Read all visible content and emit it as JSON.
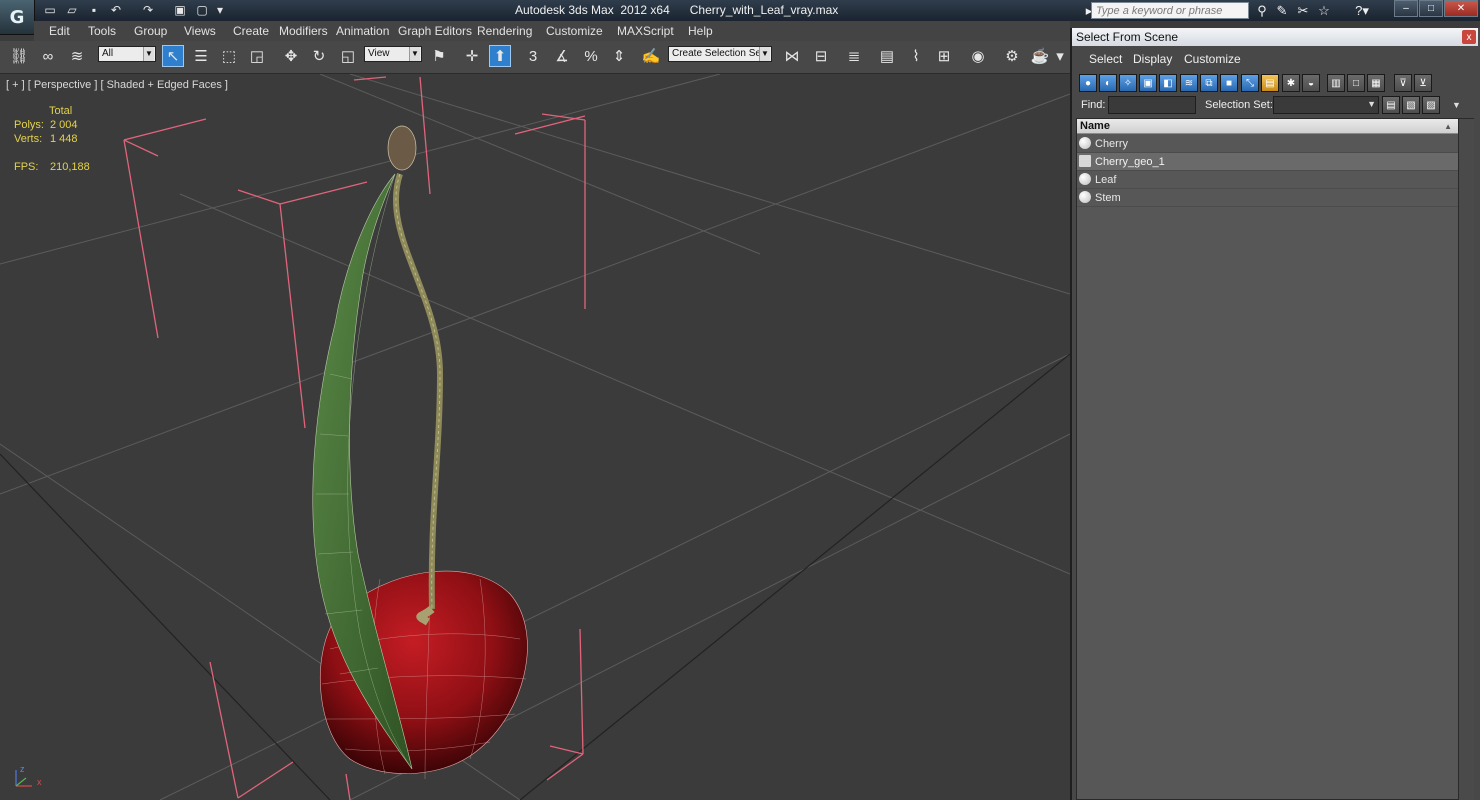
{
  "app": {
    "title": "Autodesk 3ds Max  2012 x64      Cherry_with_Leaf_vray.max",
    "search_placeholder": "Type a keyword or phrase"
  },
  "menu": [
    "Edit",
    "Tools",
    "Group",
    "Views",
    "Create",
    "Modifiers",
    "Animation",
    "Graph Editors",
    "Rendering",
    "Customize",
    "MAXScript",
    "Help"
  ],
  "toolbar": {
    "filter_value": "All",
    "refcoord_value": "View",
    "selection_set_value": "Create Selection Se",
    "snap_labels": [
      "3",
      "%"
    ]
  },
  "viewport": {
    "label": "[ + ] [ Perspective ] [ Shaded + Edged Faces ]",
    "stats_header": "Total",
    "polys_label": "Polys:",
    "polys_value": "2 004",
    "verts_label": "Verts:",
    "verts_value": "1 448",
    "fps_label": "FPS:",
    "fps_value": "210,188",
    "axis_labels": [
      "z",
      "x"
    ]
  },
  "dialog": {
    "title": "Select From Scene",
    "close_glyph": "x",
    "menu": [
      "Select",
      "Display",
      "Customize"
    ],
    "find_label": "Find:",
    "selection_set_label": "Selection Set:",
    "column_name": "Name",
    "rows": [
      {
        "name": "Cherry",
        "selected": false
      },
      {
        "name": "Cherry_geo_1",
        "selected": true
      },
      {
        "name": "Leaf",
        "selected": false
      },
      {
        "name": "Stem",
        "selected": false
      }
    ]
  },
  "colors": {
    "cherry": "#8e0f14",
    "leaf": "#3f6a2f",
    "stem": "#8f8a5a",
    "bbox": "#e0647c",
    "grid": "#5a5a5a",
    "stats": "#e3d24a"
  }
}
